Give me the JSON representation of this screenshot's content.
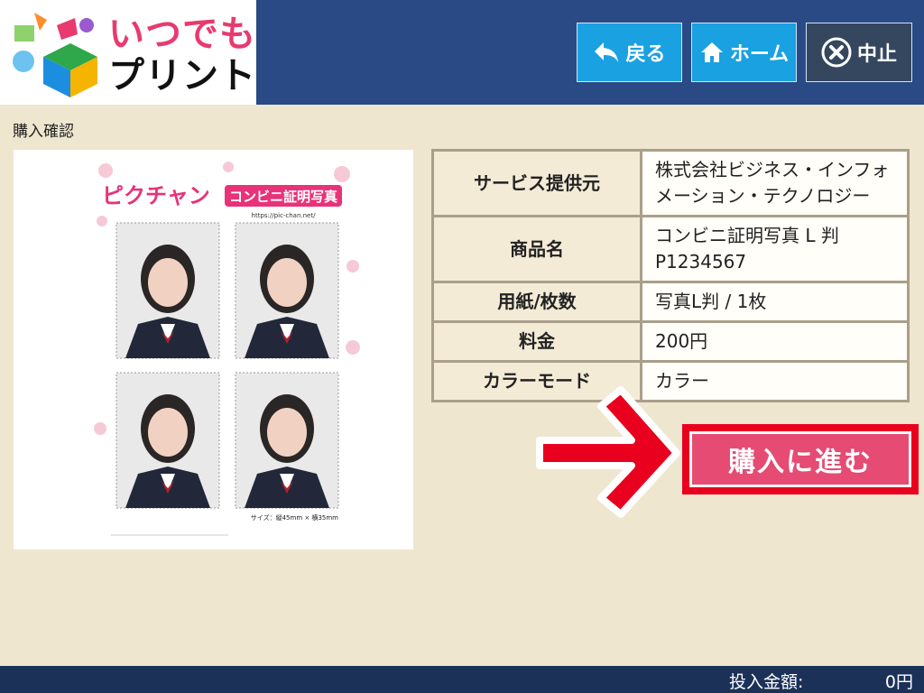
{
  "logo": {
    "line1": "いつでも",
    "line2": "プリント"
  },
  "header": {
    "back_label": "戻る",
    "home_label": "ホーム",
    "stop_label": "中止"
  },
  "page": {
    "title": "購入確認"
  },
  "preview": {
    "brand": "ピクチャン",
    "product_label": "コンビニ証明写真",
    "url": "https://pic-chan.net/",
    "size_note": "サイズ：縦45mm × 横35mm"
  },
  "info": {
    "rows": [
      {
        "key": "サービス提供元",
        "value": "株式会社ビジネス・インフォメーション・テクノロジー"
      },
      {
        "key": "商品名",
        "value": "コンビニ証明写真 L 判\nP1234567"
      },
      {
        "key": "用紙/枚数",
        "value": "写真L判 / 1枚"
      },
      {
        "key": "料金",
        "value": "200円"
      },
      {
        "key": "カラーモード",
        "value": "カラー"
      }
    ]
  },
  "proceed": {
    "label": "購入に進む"
  },
  "footer": {
    "label": "投入金額:",
    "amount": "0円"
  },
  "colors": {
    "header_bg": "#2a4a86",
    "button_blue": "#1aa1e1",
    "button_dark": "#35475f",
    "page_bg": "#efe6cf",
    "proceed_pink": "#e54b73",
    "highlight_red": "#e8001e",
    "footer_bg": "#1c3158"
  }
}
